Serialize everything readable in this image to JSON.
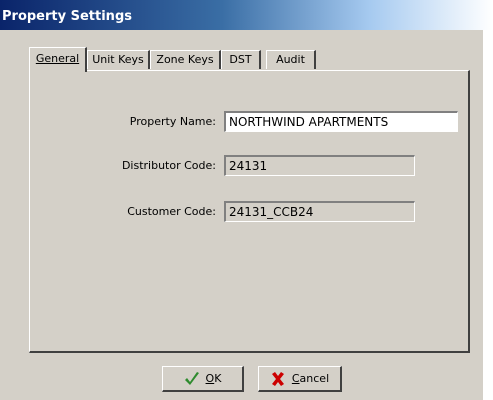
{
  "window": {
    "title": "Property Settings"
  },
  "tabs": [
    {
      "label": "General",
      "active": true
    },
    {
      "label": "Unit Keys",
      "active": false
    },
    {
      "label": "Zone Keys",
      "active": false
    },
    {
      "label": "DST",
      "active": false
    },
    {
      "label": "Audit",
      "active": false
    }
  ],
  "general": {
    "property_name_label": "Property Name:",
    "property_name_value": "NORTHWIND APARTMENTS",
    "distributor_code_label": "Distributor Code:",
    "distributor_code_value": "24131",
    "customer_code_label": "Customer Code:",
    "customer_code_value": "24131_CCB24"
  },
  "buttons": {
    "ok_label": "OK",
    "ok_icon": "checkmark-icon",
    "cancel_label": "Cancel",
    "cancel_icon": "x-icon"
  },
  "colors": {
    "dialog_face": "#d4d0c8",
    "title_bar_start": "#0a246a",
    "ok_icon_color": "#2e8b2e",
    "cancel_icon_color": "#cc0000"
  }
}
